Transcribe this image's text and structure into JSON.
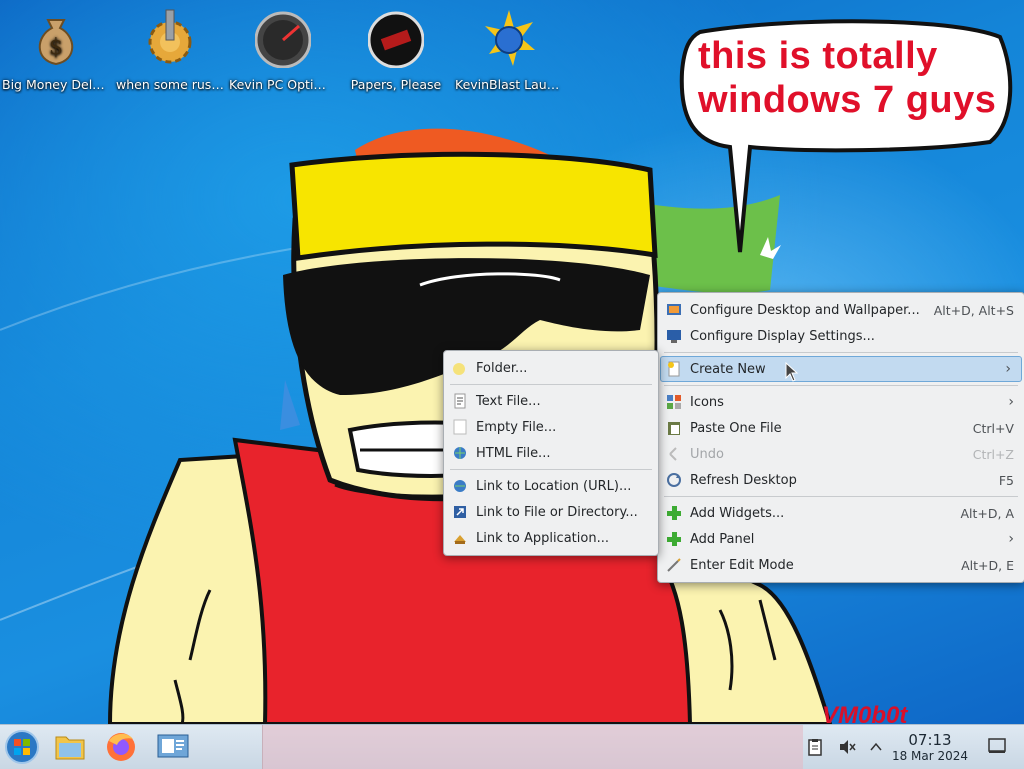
{
  "desktop_icons": [
    {
      "label": "Big Money Deluxe",
      "icon": "money-bag-icon"
    },
    {
      "label": "when some russian runs a...",
      "icon": "gear-lock-icon"
    },
    {
      "label": "Kevin PC Optimizer Ho...",
      "icon": "gauge-icon"
    },
    {
      "label": "Papers, Please",
      "icon": "papers-please-icon"
    },
    {
      "label": "KevinBlast Launcher",
      "icon": "kevinblast-icon"
    }
  ],
  "bubble_text": [
    "this is totally",
    "windows 7 guys"
  ],
  "watermark": "VM0b0t",
  "main_menu": {
    "configure_desktop": {
      "label": "Configure Desktop and Wallpaper...",
      "shortcut": "Alt+D, Alt+S"
    },
    "configure_display": {
      "label": "Configure Display Settings..."
    },
    "create_new": {
      "label": "Create New"
    },
    "icons": {
      "label": "Icons"
    },
    "paste": {
      "label": "Paste One File",
      "shortcut": "Ctrl+V"
    },
    "undo": {
      "label": "Undo",
      "shortcut": "Ctrl+Z"
    },
    "refresh": {
      "label": "Refresh Desktop",
      "shortcut": "F5"
    },
    "add_widgets": {
      "label": "Add Widgets...",
      "shortcut": "Alt+D, A"
    },
    "add_panel": {
      "label": "Add Panel"
    },
    "edit_mode": {
      "label": "Enter Edit Mode",
      "shortcut": "Alt+D, E"
    }
  },
  "sub_menu": {
    "folder": "Folder...",
    "text_file": "Text File...",
    "empty_file": "Empty File...",
    "html_file": "HTML File...",
    "link_url": "Link to Location (URL)...",
    "link_file": "Link to File or Directory...",
    "link_app": "Link to Application..."
  },
  "clock": {
    "time": "07:13",
    "date": "18 Mar 2024"
  },
  "colors": {
    "accent": "#c2daf0",
    "bubble_text": "#e0102a",
    "shirt": "#e8232c",
    "headband": "#f7e500",
    "skin": "#fbf3b0"
  }
}
